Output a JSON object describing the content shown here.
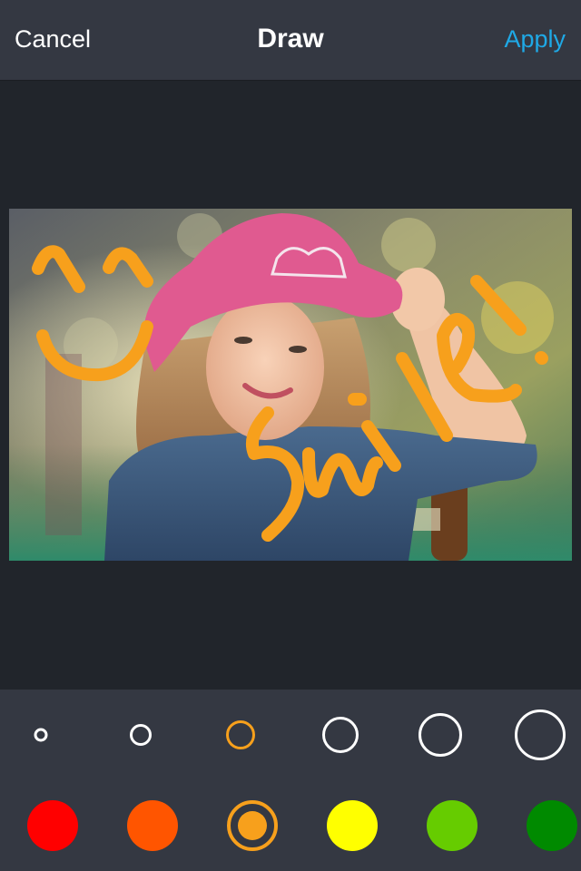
{
  "header": {
    "cancel_label": "Cancel",
    "title": "Draw",
    "apply_label": "Apply"
  },
  "drawing": {
    "stroke_color": "#f7a01c",
    "annotations": [
      "^ ^ smiley face",
      "Smile!"
    ]
  },
  "photo": {
    "description": "Smiling girl in pink cowboy hat and denim shirt"
  },
  "brush_sizes": [
    {
      "name": "size-1",
      "selected": false
    },
    {
      "name": "size-2",
      "selected": false
    },
    {
      "name": "size-3",
      "selected": true
    },
    {
      "name": "size-4",
      "selected": false
    },
    {
      "name": "size-5",
      "selected": false
    },
    {
      "name": "size-6",
      "selected": false
    }
  ],
  "colors": [
    {
      "name": "red",
      "hex": "#ff0000",
      "selected": false
    },
    {
      "name": "orange-red",
      "hex": "#ff5500",
      "selected": false
    },
    {
      "name": "orange",
      "hex": "#f7a01c",
      "selected": true
    },
    {
      "name": "yellow",
      "hex": "#ffff00",
      "selected": false
    },
    {
      "name": "light-green",
      "hex": "#66cc00",
      "selected": false
    },
    {
      "name": "green",
      "hex": "#008a00",
      "selected": false
    }
  ],
  "accent_color": "#1fa9e6"
}
